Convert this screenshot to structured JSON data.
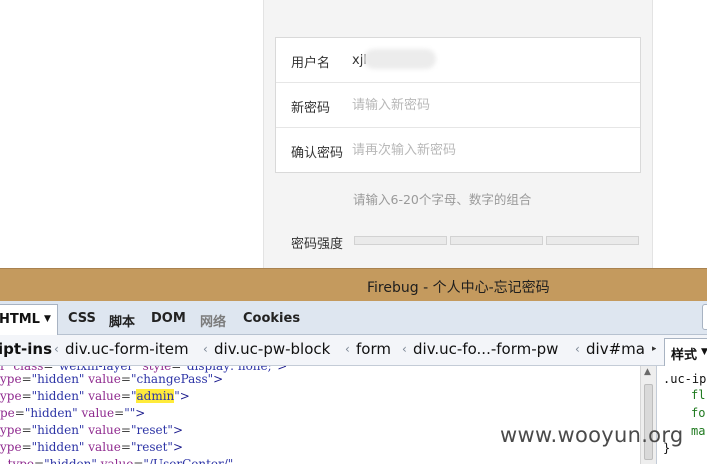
{
  "webpage": {
    "form": {
      "username_label": "用户名",
      "username_value": "xjl",
      "new_password_label": "新密码",
      "new_password_placeholder": "请输入新密码",
      "confirm_password_label": "确认密码",
      "confirm_password_placeholder": "请再次输入新密码"
    },
    "hint": "请输入6-20个字母、数字的组合",
    "strength_label": "密码强度"
  },
  "firebug": {
    "title": "Firebug - 个人中心-忘记密码",
    "tabs": {
      "html": "HTML",
      "css": "CSS",
      "script": "脚本",
      "dom": "DOM",
      "net": "网络",
      "cookies": "Cookies"
    },
    "breadcrumbs": [
      "ipt-ins",
      "div.uc-form-item",
      "div.uc-pw-block",
      "form",
      "div.uc-fo...-form-pw",
      "div#ma"
    ],
    "code_lines": [
      {
        "attr": "ype",
        "val": "hidden",
        "attr2": "value",
        "val2": "changePass"
      },
      {
        "attr": "ype",
        "val": "hidden",
        "attr2": "value",
        "val2": "admin"
      },
      {
        "attr": "pe",
        "val": "hidden",
        "attr2": "value",
        "val2": ""
      },
      {
        "attr": "ype",
        "val": "hidden",
        "attr2": "value",
        "val2": "reset"
      },
      {
        "attr": "ype",
        "val": "hidden",
        "attr2": "value",
        "val2": "reset"
      }
    ],
    "side_panel": {
      "tab_label": "样式",
      "selector": ".uc-ip",
      "props": [
        "fl",
        "fo",
        "ma"
      ],
      "brace": "}"
    }
  },
  "watermark": "www.wooyun.org",
  "colors": {
    "firebug_titlebar": "#c49a5e",
    "firebug_tabbar": "#dee6f0",
    "highlight": "#ffeb3b"
  }
}
